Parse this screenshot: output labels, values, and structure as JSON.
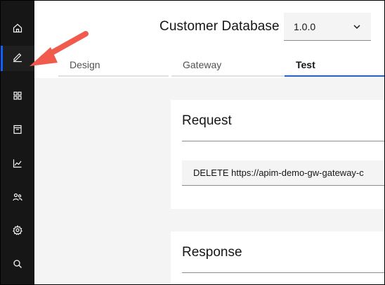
{
  "app": {
    "title": "Customer Database",
    "version_select": {
      "value": "1.0.0"
    }
  },
  "sidebar": {
    "items": [
      {
        "name": "home",
        "icon": "home-icon",
        "active": false
      },
      {
        "name": "develop",
        "icon": "edit-pencil-icon",
        "active": true
      },
      {
        "name": "apps",
        "icon": "grid-icon",
        "active": false
      },
      {
        "name": "catalog",
        "icon": "archive-icon",
        "active": false
      },
      {
        "name": "analytics",
        "icon": "chart-line-icon",
        "active": false
      },
      {
        "name": "consumers",
        "icon": "user-group-icon",
        "active": false
      },
      {
        "name": "settings",
        "icon": "gear-icon",
        "active": false
      },
      {
        "name": "search",
        "icon": "search-icon",
        "active": false
      }
    ]
  },
  "tabs": [
    {
      "label": "Design",
      "active": false
    },
    {
      "label": "Gateway",
      "active": false
    },
    {
      "label": "Test",
      "active": true
    }
  ],
  "request": {
    "heading": "Request",
    "line": "DELETE https://apim-demo-gw-gateway-c"
  },
  "response": {
    "heading": "Response"
  },
  "annotation": {
    "arrow_color": "#f15b4e",
    "target": "edit-pencil-icon"
  },
  "colors": {
    "accent": "#0f62fe",
    "sidebar_bg": "#161616"
  }
}
